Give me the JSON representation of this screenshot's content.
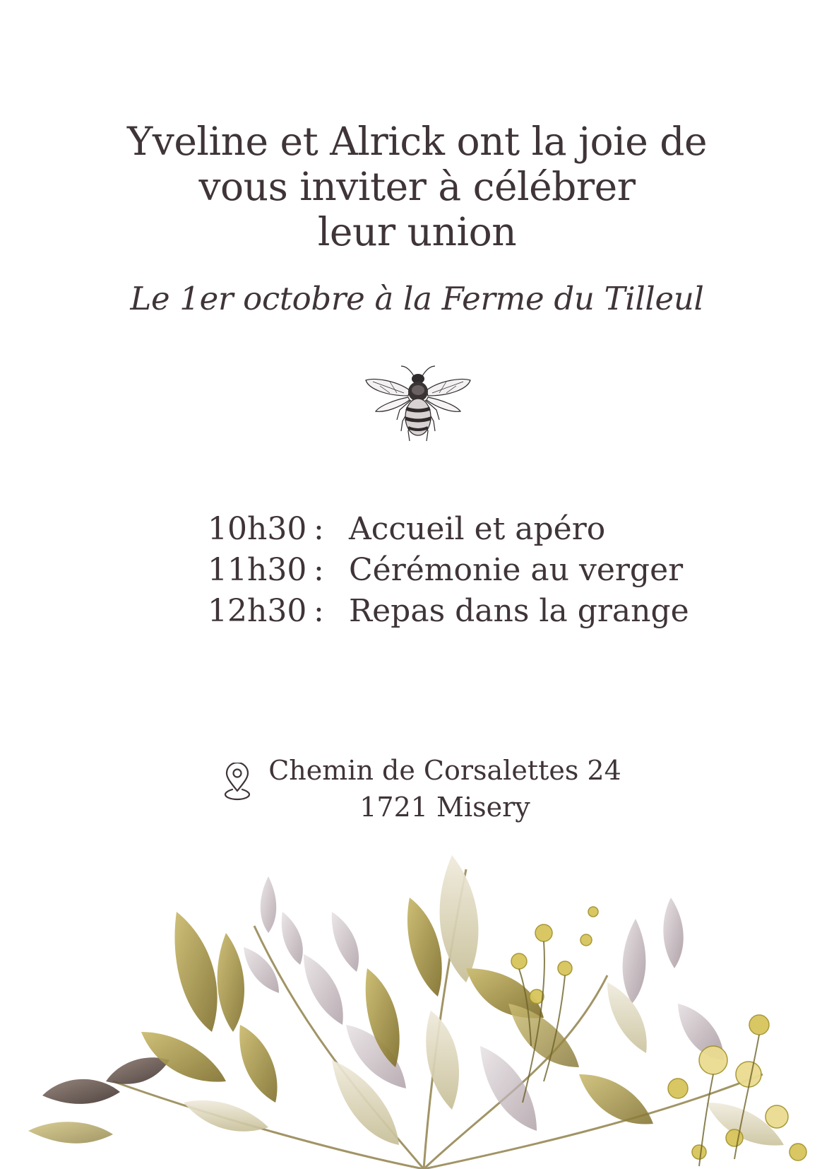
{
  "invitation": {
    "headline_lines": [
      "Yveline et Alrick ont la joie de",
      "vous inviter à célébrer",
      "leur union"
    ],
    "subtitle": "Le 1er octobre à la Ferme du Tilleul",
    "schedule": [
      {
        "time": "10h30",
        "separator": ":",
        "event": "Accueil et apéro"
      },
      {
        "time": "11h30",
        "separator": ":",
        "event": "Cérémonie au verger"
      },
      {
        "time": "12h30",
        "separator": ":",
        "event": "Repas dans la grange"
      }
    ],
    "address": {
      "line1": "Chemin de Corsalettes 24",
      "line2": "1721 Misery"
    }
  },
  "icons": {
    "bee": "bee-illustration",
    "location": "location-pin-icon"
  },
  "colors": {
    "text": "#3f3438",
    "leaf_olive": "#9a8a3c",
    "leaf_mauve": "#b7a9ae",
    "flower_yellow": "#d9c45c"
  }
}
